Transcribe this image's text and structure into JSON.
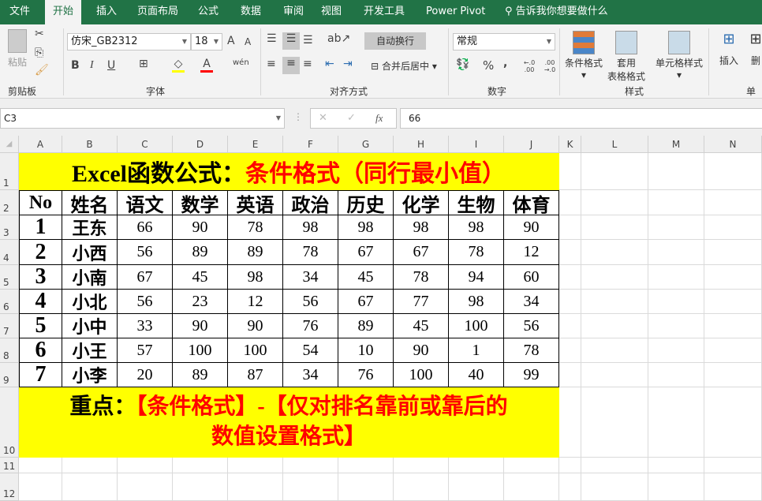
{
  "tabs": [
    "文件",
    "开始",
    "插入",
    "页面布局",
    "公式",
    "数据",
    "审阅",
    "视图",
    "开发工具",
    "Power Pivot"
  ],
  "tell_me": "告诉我你想要做什么",
  "ribbon": {
    "clipboard": {
      "paste": "粘贴",
      "label": "剪贴板"
    },
    "font": {
      "name": "仿宋_GB2312",
      "size": "18",
      "bold": "B",
      "italic": "I",
      "underline": "U",
      "grow": "A",
      "shrink": "A",
      "font_color": "A",
      "phonetic": "wén",
      "label": "字体"
    },
    "align": {
      "wrap": "自动换行",
      "merge": "合并后居中",
      "label": "对齐方式"
    },
    "number": {
      "format": "常规",
      "percent": "%",
      "comma": ",",
      "inc": "←.0 .00",
      "dec": ".00 →.0",
      "label": "数字"
    },
    "styles": {
      "cond": "条件格式",
      "table1": "套用",
      "table2": "表格格式",
      "cell": "单元格样式",
      "label": "样式"
    },
    "cells": {
      "insert": "插入",
      "delete": "删",
      "label": "单元"
    }
  },
  "formula_bar": {
    "name_box": "C3",
    "value": "66",
    "fx": "fx"
  },
  "columns": [
    "A",
    "B",
    "C",
    "D",
    "E",
    "F",
    "G",
    "H",
    "I",
    "J",
    "K",
    "L",
    "M",
    "N"
  ],
  "rows": [
    "1",
    "2",
    "3",
    "4",
    "5",
    "6",
    "7",
    "8",
    "9",
    "10",
    "11",
    "12"
  ],
  "sheet": {
    "title_black": "Excel函数公式：",
    "title_red": "条件格式（同行最小值）",
    "headers": [
      "No",
      "姓名",
      "语文",
      "数学",
      "英语",
      "政治",
      "历史",
      "化学",
      "生物",
      "体育"
    ],
    "data": [
      [
        "1",
        "王东",
        "66",
        "90",
        "78",
        "98",
        "98",
        "98",
        "98",
        "90"
      ],
      [
        "2",
        "小西",
        "56",
        "89",
        "89",
        "78",
        "67",
        "67",
        "78",
        "12"
      ],
      [
        "3",
        "小南",
        "67",
        "45",
        "98",
        "34",
        "45",
        "78",
        "94",
        "60"
      ],
      [
        "4",
        "小北",
        "56",
        "23",
        "12",
        "56",
        "67",
        "77",
        "98",
        "34"
      ],
      [
        "5",
        "小中",
        "33",
        "90",
        "90",
        "76",
        "89",
        "45",
        "100",
        "56"
      ],
      [
        "6",
        "小王",
        "57",
        "100",
        "100",
        "54",
        "10",
        "90",
        "1",
        "78"
      ],
      [
        "7",
        "小李",
        "20",
        "89",
        "87",
        "34",
        "76",
        "100",
        "40",
        "99"
      ]
    ],
    "note_black": "重点：",
    "note_red1": "【条件格式】-【仅对排名靠前或靠后的",
    "note_red2": "数值设置格式】"
  },
  "colors": {
    "excel_green": "#217346",
    "yellow": "#ffff00",
    "red": "#ff0000"
  }
}
